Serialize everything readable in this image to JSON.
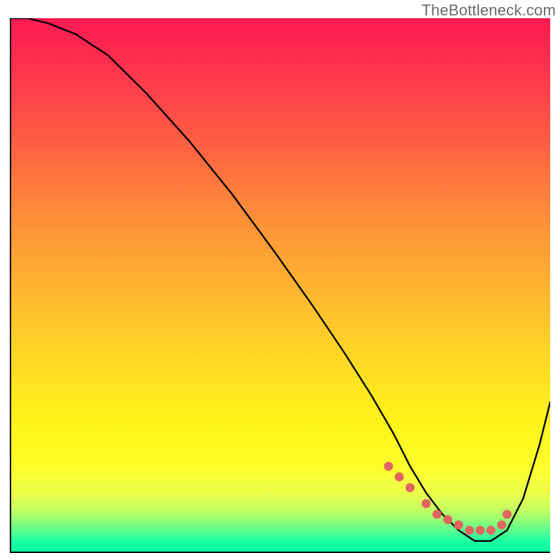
{
  "watermark": "TheBottleneck.com",
  "chart_data": {
    "type": "line",
    "title": "",
    "xlabel": "",
    "ylabel": "",
    "xlim": [
      0,
      100
    ],
    "ylim": [
      0,
      100
    ],
    "series": [
      {
        "name": "bottleneck-curve",
        "x": [
          0,
          3,
          7,
          12,
          18,
          25,
          33,
          41,
          49,
          56,
          62,
          67,
          71,
          74,
          77,
          80,
          83,
          86,
          89,
          92,
          95,
          98,
          100
        ],
        "y": [
          100,
          100,
          99,
          97,
          93,
          86,
          77,
          67,
          56,
          46,
          37,
          29,
          22,
          16,
          11,
          7,
          4,
          2,
          2,
          4,
          10,
          20,
          28
        ]
      }
    ],
    "markers": {
      "name": "highlight-dots",
      "x": [
        70,
        72,
        74,
        77,
        79,
        81,
        83,
        85,
        87,
        89,
        91,
        92
      ],
      "y": [
        16,
        14,
        12,
        9,
        7,
        6,
        5,
        4,
        4,
        4,
        5,
        7
      ]
    },
    "background": "heatmap-gradient-red-to-green"
  }
}
